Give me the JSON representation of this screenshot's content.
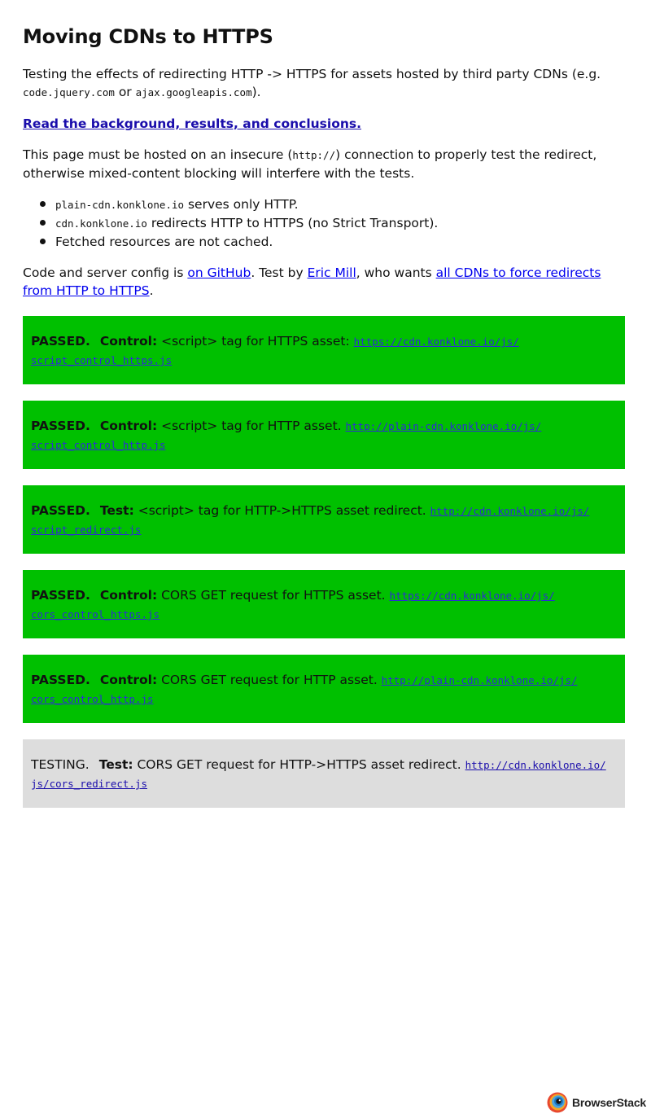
{
  "page": {
    "title": "Moving CDNs to HTTPS"
  },
  "intro": {
    "text_before": "Testing the effects of redirecting HTTP -> HTTPS for assets hosted by third party CDNs (e.g. ",
    "code1": "code.jquery.com",
    "or": " or ",
    "code2": "ajax.googleapis.com",
    "text_after": ")."
  },
  "background_link": {
    "label": "Read the background, results, and conclusions."
  },
  "insecure": {
    "text_before": "This page must be hosted on an insecure (",
    "code": "http://",
    "text_after": ") connection to properly test the redirect, otherwise mixed-content blocking will interfere with the tests."
  },
  "notes": [
    {
      "code": "plain-cdn.konklone.io",
      "text": " serves only HTTP."
    },
    {
      "code": "cdn.konklone.io",
      "text": " redirects HTTP to HTTPS (no Strict Transport)."
    },
    {
      "code": "",
      "text": "Fetched resources are not cached."
    }
  ],
  "credits": {
    "t1": "Code and server config is ",
    "github_link": "on GitHub",
    "t2": ". Test by ",
    "author_link": "Eric Mill",
    "t3": ", who wants ",
    "cause_link": "all CDNs to force redirects from HTTP to HTTPS",
    "t4": "."
  },
  "tests": [
    {
      "status": "PASSED.",
      "kind": "Control:",
      "description": " <script> tag for HTTPS asset: ",
      "url": "https://cdn.konklone.io/js/script_control_https.js",
      "url_line1": "https://cdn.konklone.io/js/",
      "url_line2": "script_control_https.js"
    },
    {
      "status": "PASSED.",
      "kind": "Control:",
      "description": " <script> tag for HTTP asset. ",
      "url": "http://plain-cdn.konklone.io/js/script_control_http.js",
      "url_line1": "http://plain-cdn.konklone.io/js/",
      "url_line2": "script_control_http.js"
    },
    {
      "status": "PASSED.",
      "kind": "Test:",
      "description": " <script> tag for HTTP->HTTPS asset redirect. ",
      "url": "http://cdn.konklone.io/js/script_redirect.js",
      "url_line1": "http://cdn.konklone.io/js/",
      "url_line2": "script_redirect.js"
    },
    {
      "status": "PASSED.",
      "kind": "Control:",
      "description": " CORS GET request for HTTPS asset. ",
      "url": "https://cdn.konklone.io/js/cors_control_https.js",
      "url_line1": "https://cdn.konklone.io/js/",
      "url_line2": "cors_control_https.js"
    },
    {
      "status": "PASSED.",
      "kind": "Control:",
      "description": " CORS GET request for HTTP asset. ",
      "url": "http://plain-cdn.konklone.io/js/cors_control_http.js",
      "url_line1": "http://plain-cdn.konklone.io/js/",
      "url_line2": "cors_control_http.js"
    },
    {
      "status": "TESTING.",
      "kind": "Test:",
      "description": " CORS GET request for HTTP->HTTPS asset redirect. ",
      "url": "http://cdn.konklone.io/js/cors_redirect.js",
      "url_line1": "http://cdn.konklone.io/",
      "url_line2": "js/cors_redirect.js"
    }
  ],
  "badge": {
    "label": "BrowserStack",
    "icon": "browserstack-logo-icon"
  },
  "colors": {
    "passed": "#00c000",
    "testing": "#dddddd",
    "link": "#1a0dab"
  }
}
